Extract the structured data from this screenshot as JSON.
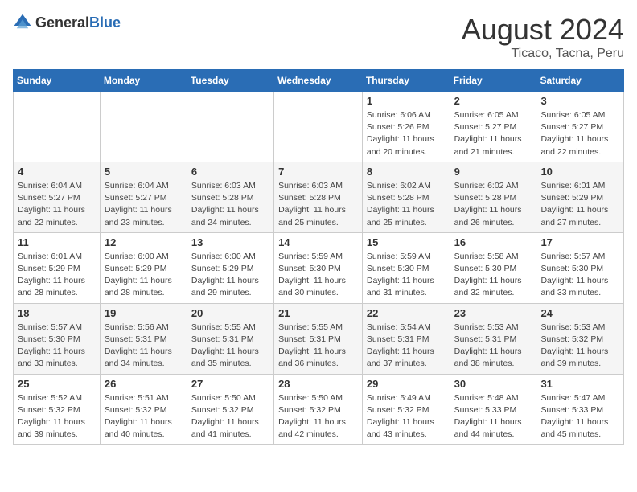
{
  "header": {
    "logo_general": "General",
    "logo_blue": "Blue",
    "month_year": "August 2024",
    "location": "Ticaco, Tacna, Peru"
  },
  "weekdays": [
    "Sunday",
    "Monday",
    "Tuesday",
    "Wednesday",
    "Thursday",
    "Friday",
    "Saturday"
  ],
  "weeks": [
    [
      {
        "day": "",
        "info": ""
      },
      {
        "day": "",
        "info": ""
      },
      {
        "day": "",
        "info": ""
      },
      {
        "day": "",
        "info": ""
      },
      {
        "day": "1",
        "info": "Sunrise: 6:06 AM\nSunset: 5:26 PM\nDaylight: 11 hours and 20 minutes."
      },
      {
        "day": "2",
        "info": "Sunrise: 6:05 AM\nSunset: 5:27 PM\nDaylight: 11 hours and 21 minutes."
      },
      {
        "day": "3",
        "info": "Sunrise: 6:05 AM\nSunset: 5:27 PM\nDaylight: 11 hours and 22 minutes."
      }
    ],
    [
      {
        "day": "4",
        "info": "Sunrise: 6:04 AM\nSunset: 5:27 PM\nDaylight: 11 hours and 22 minutes."
      },
      {
        "day": "5",
        "info": "Sunrise: 6:04 AM\nSunset: 5:27 PM\nDaylight: 11 hours and 23 minutes."
      },
      {
        "day": "6",
        "info": "Sunrise: 6:03 AM\nSunset: 5:28 PM\nDaylight: 11 hours and 24 minutes."
      },
      {
        "day": "7",
        "info": "Sunrise: 6:03 AM\nSunset: 5:28 PM\nDaylight: 11 hours and 25 minutes."
      },
      {
        "day": "8",
        "info": "Sunrise: 6:02 AM\nSunset: 5:28 PM\nDaylight: 11 hours and 25 minutes."
      },
      {
        "day": "9",
        "info": "Sunrise: 6:02 AM\nSunset: 5:28 PM\nDaylight: 11 hours and 26 minutes."
      },
      {
        "day": "10",
        "info": "Sunrise: 6:01 AM\nSunset: 5:29 PM\nDaylight: 11 hours and 27 minutes."
      }
    ],
    [
      {
        "day": "11",
        "info": "Sunrise: 6:01 AM\nSunset: 5:29 PM\nDaylight: 11 hours and 28 minutes."
      },
      {
        "day": "12",
        "info": "Sunrise: 6:00 AM\nSunset: 5:29 PM\nDaylight: 11 hours and 28 minutes."
      },
      {
        "day": "13",
        "info": "Sunrise: 6:00 AM\nSunset: 5:29 PM\nDaylight: 11 hours and 29 minutes."
      },
      {
        "day": "14",
        "info": "Sunrise: 5:59 AM\nSunset: 5:30 PM\nDaylight: 11 hours and 30 minutes."
      },
      {
        "day": "15",
        "info": "Sunrise: 5:59 AM\nSunset: 5:30 PM\nDaylight: 11 hours and 31 minutes."
      },
      {
        "day": "16",
        "info": "Sunrise: 5:58 AM\nSunset: 5:30 PM\nDaylight: 11 hours and 32 minutes."
      },
      {
        "day": "17",
        "info": "Sunrise: 5:57 AM\nSunset: 5:30 PM\nDaylight: 11 hours and 33 minutes."
      }
    ],
    [
      {
        "day": "18",
        "info": "Sunrise: 5:57 AM\nSunset: 5:30 PM\nDaylight: 11 hours and 33 minutes."
      },
      {
        "day": "19",
        "info": "Sunrise: 5:56 AM\nSunset: 5:31 PM\nDaylight: 11 hours and 34 minutes."
      },
      {
        "day": "20",
        "info": "Sunrise: 5:55 AM\nSunset: 5:31 PM\nDaylight: 11 hours and 35 minutes."
      },
      {
        "day": "21",
        "info": "Sunrise: 5:55 AM\nSunset: 5:31 PM\nDaylight: 11 hours and 36 minutes."
      },
      {
        "day": "22",
        "info": "Sunrise: 5:54 AM\nSunset: 5:31 PM\nDaylight: 11 hours and 37 minutes."
      },
      {
        "day": "23",
        "info": "Sunrise: 5:53 AM\nSunset: 5:31 PM\nDaylight: 11 hours and 38 minutes."
      },
      {
        "day": "24",
        "info": "Sunrise: 5:53 AM\nSunset: 5:32 PM\nDaylight: 11 hours and 39 minutes."
      }
    ],
    [
      {
        "day": "25",
        "info": "Sunrise: 5:52 AM\nSunset: 5:32 PM\nDaylight: 11 hours and 39 minutes."
      },
      {
        "day": "26",
        "info": "Sunrise: 5:51 AM\nSunset: 5:32 PM\nDaylight: 11 hours and 40 minutes."
      },
      {
        "day": "27",
        "info": "Sunrise: 5:50 AM\nSunset: 5:32 PM\nDaylight: 11 hours and 41 minutes."
      },
      {
        "day": "28",
        "info": "Sunrise: 5:50 AM\nSunset: 5:32 PM\nDaylight: 11 hours and 42 minutes."
      },
      {
        "day": "29",
        "info": "Sunrise: 5:49 AM\nSunset: 5:32 PM\nDaylight: 11 hours and 43 minutes."
      },
      {
        "day": "30",
        "info": "Sunrise: 5:48 AM\nSunset: 5:33 PM\nDaylight: 11 hours and 44 minutes."
      },
      {
        "day": "31",
        "info": "Sunrise: 5:47 AM\nSunset: 5:33 PM\nDaylight: 11 hours and 45 minutes."
      }
    ]
  ]
}
